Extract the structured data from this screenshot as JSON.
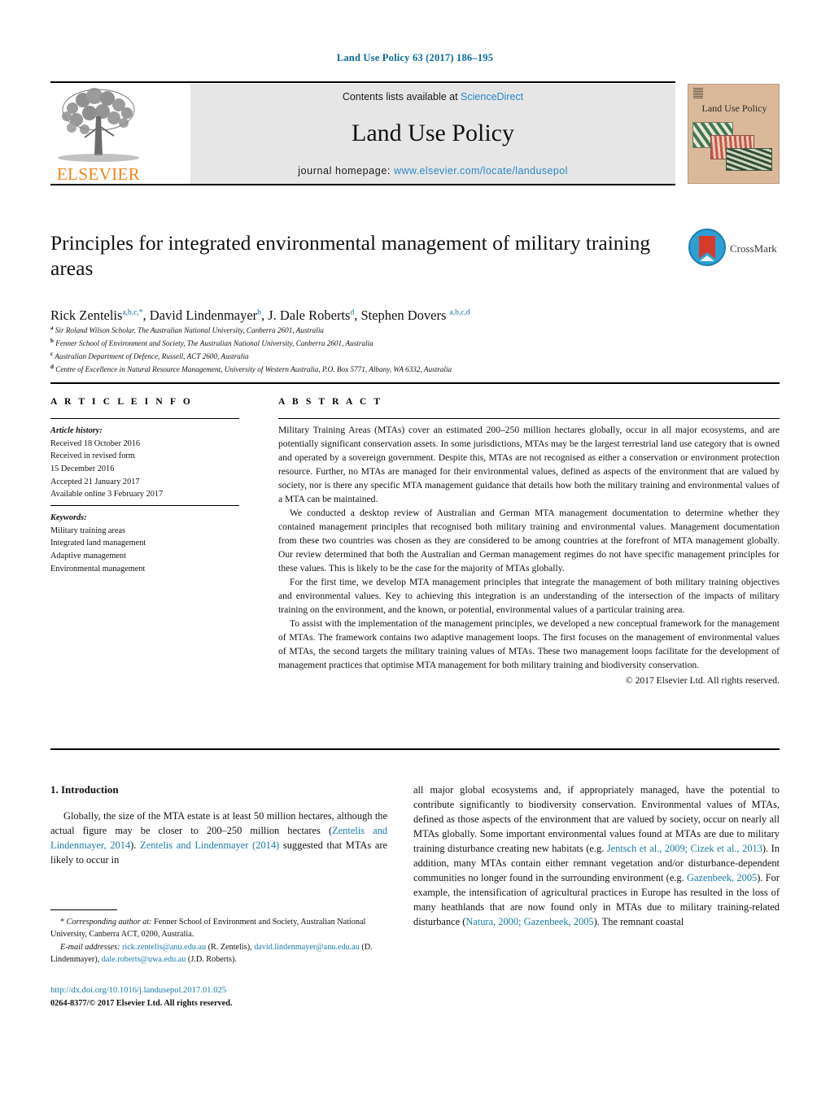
{
  "running_head": "Land Use Policy 63 (2017) 186–195",
  "masthead": {
    "contents_prefix": "Contents lists available at ",
    "contents_link": "ScienceDirect",
    "journal_name": "Land Use Policy",
    "homepage_prefix": "journal homepage: ",
    "homepage_url": "www.elsevier.com/locate/landusepol",
    "publisher": "ELSEVIER",
    "cover_title": "Land Use Policy"
  },
  "crossmark": {
    "label": "CrossMark"
  },
  "article": {
    "title": "Principles for integrated environmental management of military training areas",
    "authors_html": "Rick Zentelis<sup>a,b,c,*</sup>, David Lindenmayer<sup>b</sup>, J. Dale Roberts<sup>d</sup>, Stephen Dovers <sup>a,b,c,d</sup>",
    "affiliations": [
      {
        "mark": "a",
        "text": "Sir Roland Wilson Scholar, The Australian National University, Canberra 2601, Australia"
      },
      {
        "mark": "b",
        "text": "Fenner School of Environment and Society, The Australian National University, Canberra 2601, Australia"
      },
      {
        "mark": "c",
        "text": "Australian Department of Defence, Russell, ACT 2600, Australia"
      },
      {
        "mark": "d",
        "text": "Centre of Excellence in Natural Resource Management, University of Western Australia, P.O. Box 5771, Albany, WA 6332, Australia"
      }
    ]
  },
  "info": {
    "heading": "A R T I C L E  I N F O",
    "history_label": "Article history:",
    "history": [
      "Received 18 October 2016",
      "Received in revised form",
      "15 December 2016",
      "Accepted 21 January 2017",
      "Available online 3 February 2017"
    ],
    "keywords_label": "Keywords:",
    "keywords": [
      "Military training areas",
      "Integrated land management",
      "Adaptive management",
      "Environmental management"
    ]
  },
  "abstract": {
    "heading": "A B S T R A C T",
    "paragraphs": [
      "Military Training Areas (MTAs) cover an estimated 200–250 million hectares globally, occur in all major ecosystems, and are potentially significant conservation assets. In some jurisdictions, MTAs may be the largest terrestrial land use category that is owned and operated by a sovereign government. Despite this, MTAs are not recognised as either a conservation or environment protection resource. Further, no MTAs are managed for their environmental values, defined as aspects of the environment that are valued by society, nor is there any specific MTA management guidance that details how both the military training and environmental values of a MTA can be maintained.",
      "We conducted a desktop review of Australian and German MTA management documentation to determine whether they contained management principles that recognised both military training and environmental values. Management documentation from these two countries was chosen as they are considered to be among countries at the forefront of MTA management globally. Our review determined that both the Australian and German management regimes do not have specific management principles for these values. This is likely to be the case for the majority of MTAs globally.",
      "For the first time, we develop MTA management principles that integrate the management of both military training objectives and environmental values. Key to achieving this integration is an understanding of the intersection of the impacts of military training on the environment, and the known, or potential, environmental values of a particular training area.",
      "To assist with the implementation of the management principles, we developed a new conceptual framework for the management of MTAs. The framework contains two adaptive management loops. The first focuses on the management of environmental values of MTAs, the second targets the military training values of MTAs. These two management loops facilitate for the development of management practices that optimise MTA management for both military training and biodiversity conservation."
    ],
    "copyright": "© 2017 Elsevier Ltd. All rights reserved."
  },
  "body": {
    "section_number": "1.",
    "section_title": "Introduction",
    "left_paragraph_html": "Globally, the size of the MTA estate is at least 50 million hectares, although the actual figure may be closer to 200–250 million hectares (<span class=\"cite\">Zentelis and Lindenmayer, 2014</span>). <span class=\"cite\">Zentelis and Lindenmayer (2014)</span> suggested that MTAs are likely to occur in",
    "right_paragraph_html": "all major global ecosystems and, if appropriately managed, have the potential to contribute significantly to biodiversity conservation. Environmental values of MTAs, defined as those aspects of the environment that are valued by society, occur on nearly all MTAs globally. Some important environmental values found at MTAs are due to military training disturbance creating new habitats (e.g. <span class=\"cite\">Jentsch et al., 2009; Cizek et al., 2013</span>). In addition, many MTAs contain either remnant vegetation and/or disturbance-dependent communities no longer found in the surrounding environment (e.g. <span class=\"cite\">Gazenbeek, 2005</span>). For example, the intensification of agricultural practices in Europe has resulted in the loss of many heathlands that are now found only in MTAs due to military training-related disturbance (<span class=\"cite\">Natura, 2000; Gazenbeek, 2005</span>). The remnant coastal"
  },
  "footnotes": {
    "corresponding_html": "* <span class=\"it\">Corresponding author at:</span> Fenner School of Environment and Society, Australian National University, Canberra ACT, 0200, Australia.",
    "emails_html": "<span class=\"it\">E-mail addresses:</span> <span class=\"mail\">rick.zentelis@anu.edu.au</span> (R. Zentelis), <span class=\"mail\">david.lindenmayer@anu.edu.au</span> (D. Lindenmayer), <span class=\"mail\">dale.roberts@uwa.edu.au</span> (J.D. Roberts).",
    "doi": "http://dx.doi.org/10.1016/j.landusepol.2017.01.025",
    "issn_line": "0264-8377/© 2017 Elsevier Ltd. All rights reserved."
  }
}
